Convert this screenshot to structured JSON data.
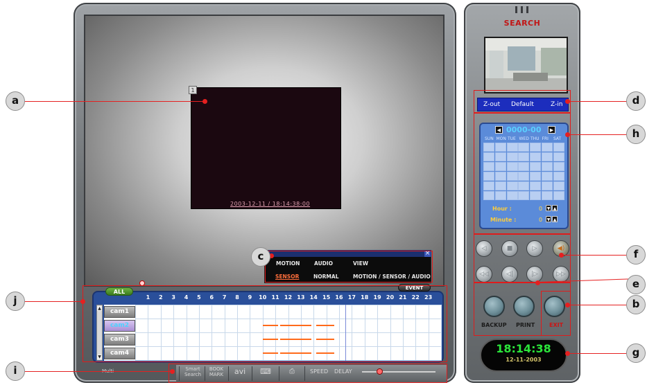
{
  "viewer": {
    "timestamp": "2003-12-11 / 18:14:38:00",
    "channel_tag": "1"
  },
  "event_popup": {
    "options_row1": [
      "MOTION",
      "AUDIO",
      "VIEW"
    ],
    "options_row2": [
      "SENSOR",
      "NORMAL",
      "MOTION / SENSOR / AUDIO"
    ],
    "selected": "SENSOR"
  },
  "timeline": {
    "all_label": "ALL",
    "event_label": "EVENT",
    "hours": [
      "1",
      "2",
      "3",
      "4",
      "5",
      "6",
      "7",
      "8",
      "9",
      "10",
      "11",
      "12",
      "13",
      "14",
      "15",
      "16",
      "17",
      "18",
      "19",
      "20",
      "21",
      "22",
      "23"
    ],
    "cameras": [
      {
        "label": "cam1",
        "active": false
      },
      {
        "label": "cam2",
        "active": true
      },
      {
        "label": "cam3",
        "active": false
      },
      {
        "label": "cam4",
        "active": false
      }
    ],
    "recordings": [
      {
        "camera": "cam2",
        "start_hour": 10.0,
        "end_hour": 11.2
      },
      {
        "camera": "cam2",
        "start_hour": 11.4,
        "end_hour": 13.8
      },
      {
        "camera": "cam2",
        "start_hour": 14.2,
        "end_hour": 15.6
      },
      {
        "camera": "cam3",
        "start_hour": 10.0,
        "end_hour": 11.2
      },
      {
        "camera": "cam3",
        "start_hour": 11.4,
        "end_hour": 13.8
      },
      {
        "camera": "cam3",
        "start_hour": 14.2,
        "end_hour": 15.6
      },
      {
        "camera": "cam4",
        "start_hour": 10.0,
        "end_hour": 11.2
      },
      {
        "camera": "cam4",
        "start_hour": 11.4,
        "end_hour": 13.8
      },
      {
        "camera": "cam4",
        "start_hour": 14.2,
        "end_hour": 15.6
      }
    ],
    "cursor_hour": 16.5
  },
  "toolbar": {
    "multi_label": "Multi",
    "smart_search": "Smart Search",
    "bookmark": "BOOK MARK",
    "avi": "avi",
    "speed_label": "SPEED",
    "delay_label": "DELAY"
  },
  "side": {
    "title": "SEARCH",
    "zoom_out": "Z-out",
    "zoom_default": "Default",
    "zoom_in": "Z-in",
    "calendar_date": "0000-00",
    "days": [
      "SUN",
      "MON",
      "TUE",
      "WED",
      "THU",
      "FRI",
      "SAT"
    ],
    "hour_label": "Hour :",
    "hour_value": "0",
    "minute_label": "Minute :",
    "minute_value": "0",
    "backup_label": "BACKUP",
    "print_label": "PRINT",
    "exit_label": "EXIT",
    "clock_time": "18:14:38",
    "clock_date": "12-11-2003"
  },
  "callouts": [
    "a",
    "b",
    "c",
    "d",
    "e",
    "f",
    "g",
    "h",
    "i",
    "j"
  ],
  "colors": {
    "annotation_red": "#e01b1b",
    "timeline_blue": "#2a4f9a",
    "recording_orange": "#ff6a1a",
    "clock_green": "#2be43a",
    "search_title_red": "#c11616"
  }
}
